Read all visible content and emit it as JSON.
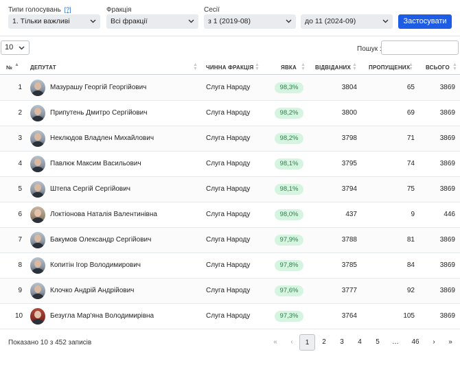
{
  "filters": {
    "vote_types_label": "Типи голосувань",
    "vote_types_help": "[?]",
    "vote_types_value": "1. Тільки важливі",
    "faction_label": "Фракція",
    "faction_value": "Всі фракції",
    "sessions_label": "Сесії",
    "session_from_value": "з 1 (2019-08)",
    "session_to_value": "до 11 (2024-09)",
    "apply_label": "Застосувати"
  },
  "table_tools": {
    "page_size_value": "10",
    "search_label": "Пошук :",
    "search_value": ""
  },
  "columns": {
    "num": "№",
    "deputy": "ДЕПУТАТ",
    "faction": "ЧИННА ФРАКЦІЯ",
    "attendance": "ЯВКА",
    "present": "ВІДВІДАНИХ",
    "missed": "ПРОПУЩЕНИХ",
    "total": "ВСЬОГО"
  },
  "rows": [
    {
      "num": "1",
      "name": "Мазурашу Георгій Георгійович",
      "faction": "Слуга Народу",
      "attendance": "98,3%",
      "present": "3804",
      "missed": "65",
      "total": "3869"
    },
    {
      "num": "2",
      "name": "Припутень Дмитро Сергійович",
      "faction": "Слуга Народу",
      "attendance": "98,2%",
      "present": "3800",
      "missed": "69",
      "total": "3869"
    },
    {
      "num": "3",
      "name": "Неклюдов Владлен Михайлович",
      "faction": "Слуга Народу",
      "attendance": "98,2%",
      "present": "3798",
      "missed": "71",
      "total": "3869"
    },
    {
      "num": "4",
      "name": "Павлюк Максим Васильович",
      "faction": "Слуга Народу",
      "attendance": "98,1%",
      "present": "3795",
      "missed": "74",
      "total": "3869"
    },
    {
      "num": "5",
      "name": "Штепа Сергій Сергійович",
      "faction": "Слуга Народу",
      "attendance": "98,1%",
      "present": "3794",
      "missed": "75",
      "total": "3869"
    },
    {
      "num": "6",
      "name": "Локтіонова Наталія Валентинівна",
      "faction": "Слуга Народу",
      "attendance": "98,0%",
      "present": "437",
      "missed": "9",
      "total": "446"
    },
    {
      "num": "7",
      "name": "Бакумов Олександр Сергійович",
      "faction": "Слуга Народу",
      "attendance": "97,9%",
      "present": "3788",
      "missed": "81",
      "total": "3869"
    },
    {
      "num": "8",
      "name": "Копитін Ігор Володимирович",
      "faction": "Слуга Народу",
      "attendance": "97,8%",
      "present": "3785",
      "missed": "84",
      "total": "3869"
    },
    {
      "num": "9",
      "name": "Клочко Андрій Андрійович",
      "faction": "Слуга Народу",
      "attendance": "97,6%",
      "present": "3777",
      "missed": "92",
      "total": "3869"
    },
    {
      "num": "10",
      "name": "Безугла Мар'яна Володимирівна",
      "faction": "Слуга Народу",
      "attendance": "97,3%",
      "present": "3764",
      "missed": "105",
      "total": "3869"
    }
  ],
  "footer": {
    "info": "Показано 10 з 452 записів",
    "first": "«",
    "prev": "‹",
    "pages": [
      "1",
      "2",
      "3",
      "4",
      "5"
    ],
    "ellipsis": "…",
    "last_page": "46",
    "next": "›",
    "last": "»",
    "active_page": "1"
  },
  "colors": {
    "accent": "#1f5ce6",
    "pill_bg": "#d5f5e1",
    "pill_text": "#2e7d4a"
  },
  "icons": {
    "select_arrow": "chevron-down-icon",
    "sort": "sort-arrows-icon",
    "avatar": "person-photo"
  }
}
